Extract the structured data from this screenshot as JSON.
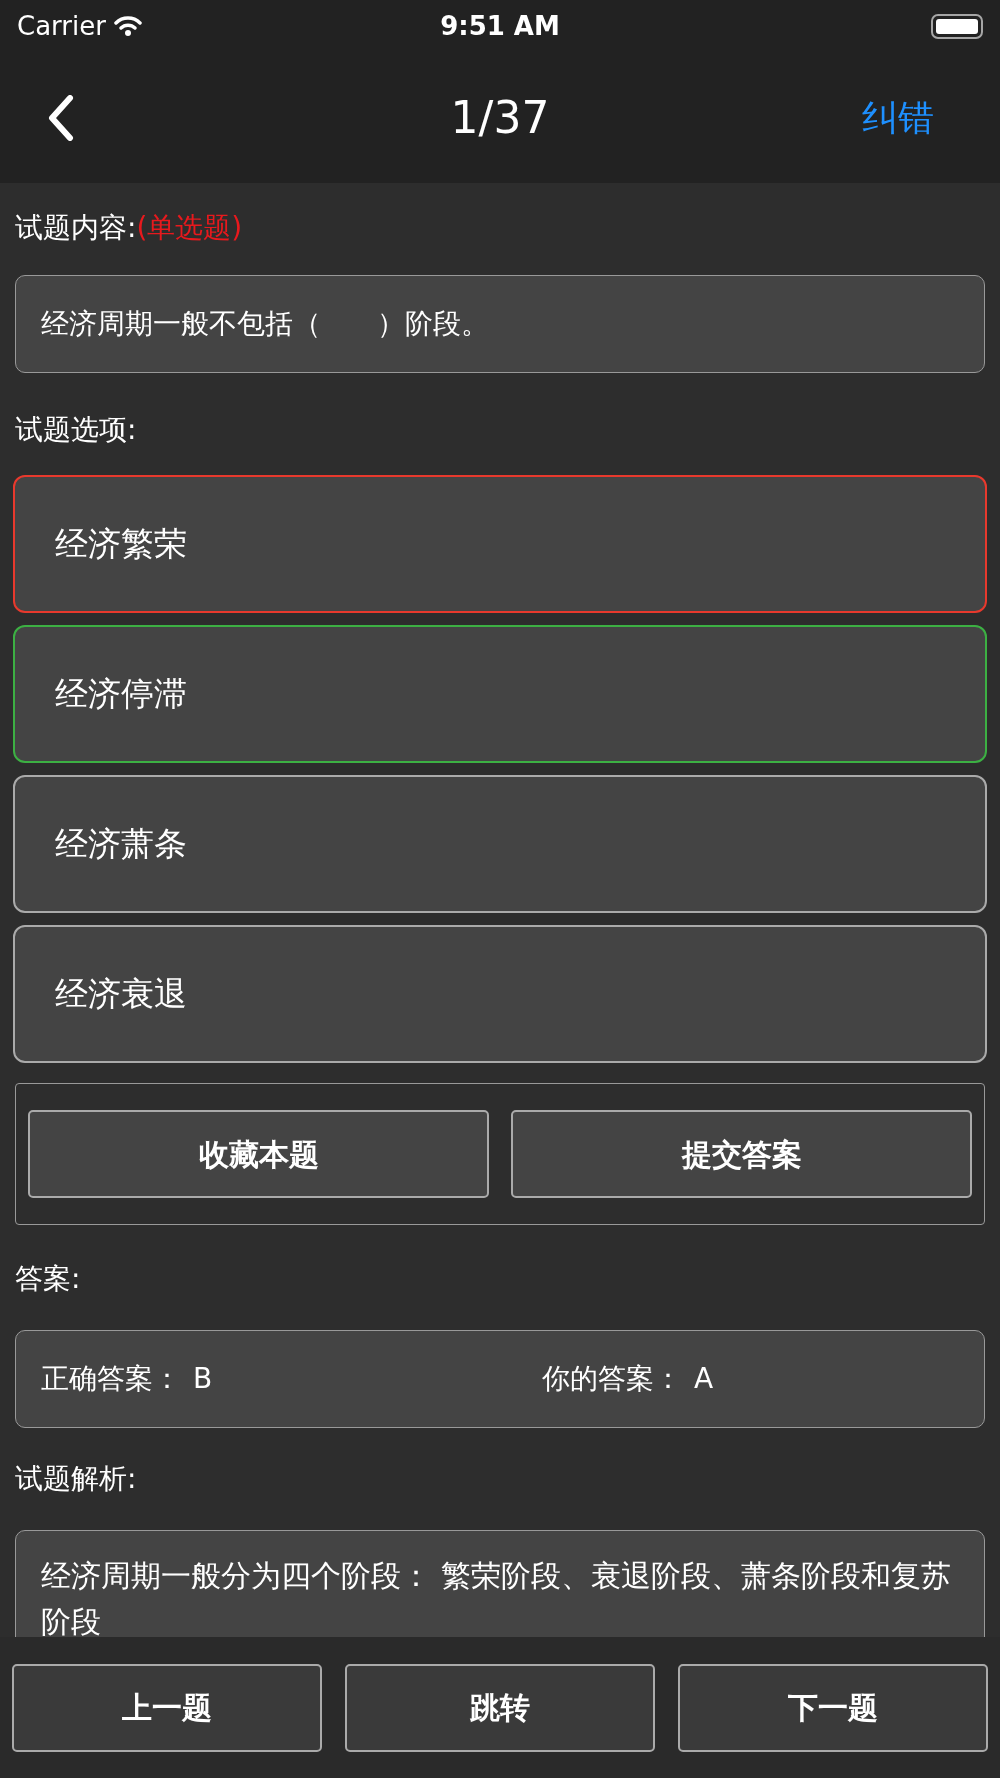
{
  "status_bar": {
    "carrier": "Carrier",
    "time": "9:51 AM"
  },
  "nav": {
    "title": "1/37",
    "action": "纠错"
  },
  "question": {
    "label": "试题内容:",
    "type": "(单选题)",
    "text": "经济周期一般不包括（　　）阶段。"
  },
  "options_label": "试题选项:",
  "options": [
    {
      "text": "经济繁荣",
      "selected": true,
      "correct": false
    },
    {
      "text": "经济停滞",
      "selected": false,
      "correct": true
    },
    {
      "text": "经济萧条",
      "selected": false,
      "correct": false
    },
    {
      "text": "经济衰退",
      "selected": false,
      "correct": false
    }
  ],
  "actions": [
    "收藏本题",
    "提交答案"
  ],
  "answer": {
    "label": "答案:",
    "correct_label": "正确答案：",
    "correct_value": "B",
    "user_label": "你的答案：",
    "user_value": "A"
  },
  "analysis": {
    "label": "试题解析:",
    "text": "经济周期一般分为四个阶段： 繁荣阶段、衰退阶段、萧条阶段和复苏阶段"
  },
  "bottom_buttons": [
    "上一题",
    "跳转",
    "下一题"
  ]
}
